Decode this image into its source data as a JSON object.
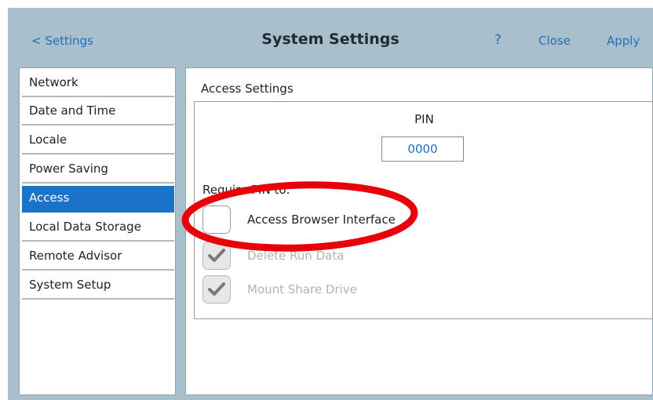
{
  "header": {
    "back_label": "< Settings",
    "title": "System Settings",
    "help_label": "?",
    "close_label": "Close",
    "apply_label": "Apply"
  },
  "sidebar": {
    "items": [
      {
        "label": "Network"
      },
      {
        "label": "Date and Time"
      },
      {
        "label": "Locale"
      },
      {
        "label": "Power Saving"
      },
      {
        "label": "Access",
        "active": true
      },
      {
        "label": "Local Data Storage"
      },
      {
        "label": "Remote Advisor"
      },
      {
        "label": "System Setup"
      }
    ]
  },
  "main": {
    "section_title": "Access Settings",
    "pin_label": "PIN",
    "pin_value": "0000",
    "require_label": "Require PIN to:",
    "options": [
      {
        "label": "Access Browser Interface",
        "checked": false,
        "enabled": true
      },
      {
        "label": "Delete Run Data",
        "checked": true,
        "enabled": false
      },
      {
        "label": "Mount Share Drive",
        "checked": true,
        "enabled": false
      }
    ]
  },
  "colors": {
    "header_bg": "#a9bfcc",
    "link_blue": "#1f6fbf",
    "active_nav": "#1a73c7",
    "annotation_red": "#e8000b"
  },
  "icons": {
    "checkmark": "checkmark-icon"
  }
}
